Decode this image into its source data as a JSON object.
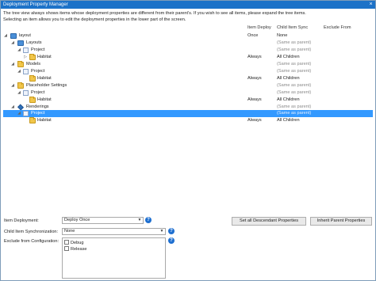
{
  "window": {
    "title": "Deployment Property Manager",
    "close": "×"
  },
  "description": {
    "line1": "The tree view always shows items whose deployment properties are different from their parent's. If you wish to see all items, please expand the tree items.",
    "line2": "Selecting an item allows you to edit the deployment properties in the lower part of the screen."
  },
  "columns": {
    "item_deploy": "Item Deploy",
    "child_sync": "Child Item Sync",
    "exclude_from": "Exclude From"
  },
  "tree": {
    "rows": [
      {
        "name": "layout",
        "deploy": "Once",
        "sync": "None"
      },
      {
        "name": "Layouts",
        "deploy": "",
        "sync": "(Same as parent)"
      },
      {
        "name": "Project",
        "deploy": "",
        "sync": "(Same as parent)"
      },
      {
        "name": "Habitat",
        "deploy": "Always",
        "sync": "All Children"
      },
      {
        "name": "Models",
        "deploy": "",
        "sync": "(Same as parent)"
      },
      {
        "name": "Project",
        "deploy": "",
        "sync": "(Same as parent)"
      },
      {
        "name": "Habitat",
        "deploy": "Always",
        "sync": "All Children"
      },
      {
        "name": "Placeholder Settings",
        "deploy": "",
        "sync": "(Same as parent)"
      },
      {
        "name": "Project",
        "deploy": "",
        "sync": "(Same as parent)"
      },
      {
        "name": "Habitat",
        "deploy": "Always",
        "sync": "All Children"
      },
      {
        "name": "Renderings",
        "deploy": "",
        "sync": "(Same as parent)"
      },
      {
        "name": "Project",
        "deploy": "",
        "sync": "(Same as parent)"
      },
      {
        "name": "Habitat",
        "deploy": "Always",
        "sync": "All Children"
      }
    ]
  },
  "form": {
    "item_deployment_label": "Item Deployment:",
    "item_deployment_value": "Deploy Once",
    "child_sync_label": "Child Item Synchronization:",
    "child_sync_value": "None",
    "exclude_label": "Exclude from Configuration:",
    "configs": [
      "Debug",
      "Release"
    ],
    "help": "?"
  },
  "buttons": {
    "set_all": "Set all Descendant Properties",
    "inherit": "Inherit Parent Properties"
  },
  "colors": {
    "title_bar": "#1c72c8",
    "selection": "#3399ff"
  }
}
